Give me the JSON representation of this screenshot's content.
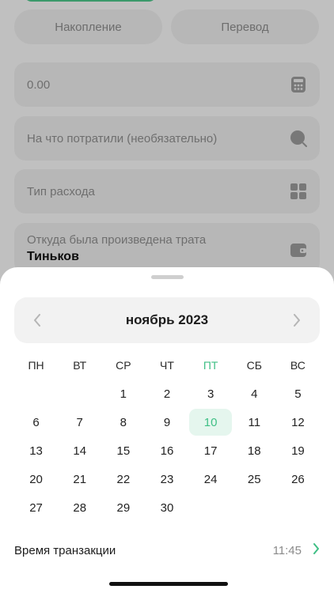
{
  "form": {
    "tabs": [
      {
        "label": "Накопление"
      },
      {
        "label": "Перевод"
      }
    ],
    "amount_placeholder": "0.00",
    "description_placeholder": "На что потратили (необязательно)",
    "expense_type_placeholder": "Тип расхода",
    "source_label": "Откуда была произведена трата",
    "source_value": "Тиньков"
  },
  "calendar": {
    "month_title": "ноябрь 2023",
    "weekdays": [
      "ПН",
      "ВТ",
      "СР",
      "ЧТ",
      "ПТ",
      "СБ",
      "ВС"
    ],
    "highlight_weekday_index": 4,
    "leading_blanks": 2,
    "days": [
      1,
      2,
      3,
      4,
      5,
      6,
      7,
      8,
      9,
      10,
      11,
      12,
      13,
      14,
      15,
      16,
      17,
      18,
      19,
      20,
      21,
      22,
      23,
      24,
      25,
      26,
      27,
      28,
      29,
      30
    ],
    "selected_day": 10
  },
  "time": {
    "label": "Время транзакции",
    "value": "11:45"
  },
  "colors": {
    "accent": "#3fbf85",
    "selected_bg": "#e5f6ee"
  }
}
